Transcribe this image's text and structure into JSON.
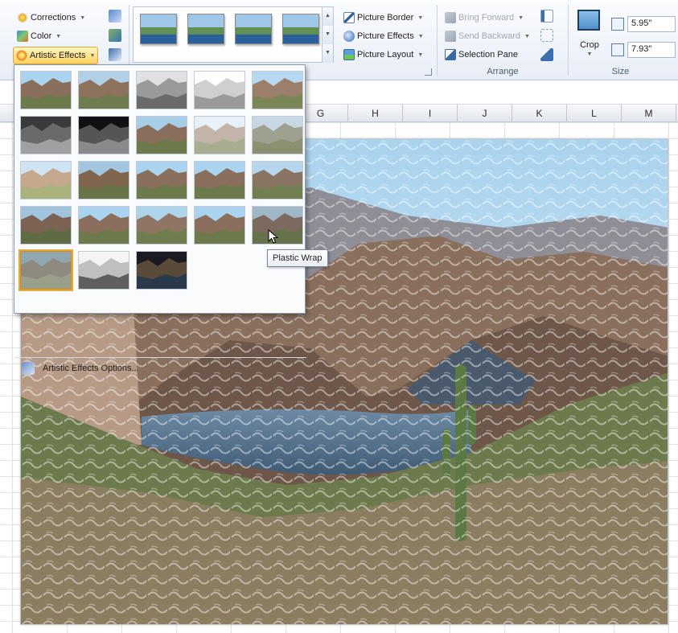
{
  "ribbon": {
    "adjust": {
      "corrections_label": "Corrections",
      "color_label": "Color",
      "artistic_effects_label": "Artistic Effects"
    },
    "picture_styles": {
      "thumb_count": 4,
      "picture_border_label": "Picture Border",
      "picture_effects_label": "Picture Effects",
      "picture_layout_label": "Picture Layout"
    },
    "arrange": {
      "bring_forward_label": "Bring Forward",
      "send_backward_label": "Send Backward",
      "selection_pane_label": "Selection Pane",
      "group_label": "Arrange"
    },
    "size": {
      "crop_label": "Crop",
      "height_value": "5.95\"",
      "width_value": "7.93\"",
      "group_label": "Size"
    }
  },
  "spreadsheet": {
    "columns": [
      "G",
      "H",
      "I",
      "J",
      "K",
      "L",
      "M"
    ]
  },
  "effects_menu": {
    "rows": 6,
    "hovered_index": 24,
    "selected_index": 25,
    "options_label": "Artistic Effects Options..."
  },
  "tooltip": {
    "text": "Plastic Wrap"
  },
  "colors": {
    "accent_hover": "#f0b84a",
    "ribbon_bg": "#e8eef7",
    "sky": "#b7dbef",
    "water": "#4f6f8c",
    "desert_green": "#6d7a4c"
  }
}
